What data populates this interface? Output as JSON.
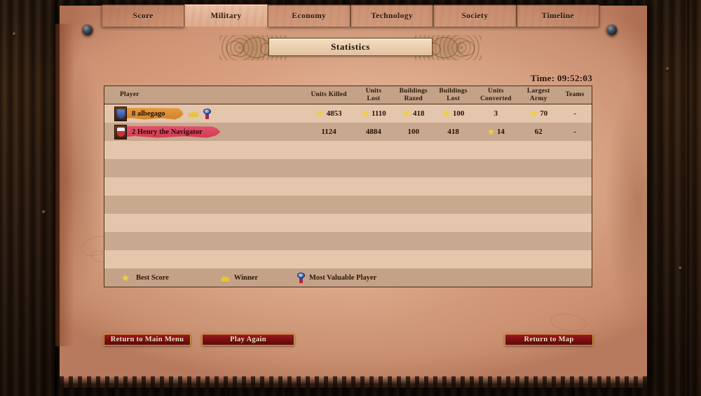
{
  "window": {
    "title": "Statistics"
  },
  "tabs": [
    {
      "id": "score",
      "label": "Score",
      "active": false
    },
    {
      "id": "military",
      "label": "Military",
      "active": true
    },
    {
      "id": "economy",
      "label": "Economy",
      "active": false
    },
    {
      "id": "technology",
      "label": "Technology",
      "active": false
    },
    {
      "id": "society",
      "label": "Society",
      "active": false
    },
    {
      "id": "timeline",
      "label": "Timeline",
      "active": false
    }
  ],
  "time": {
    "label": "Time: 09:52:03"
  },
  "table": {
    "headers": {
      "player": "Player",
      "units_killed": "Units Killed",
      "units_lost_1": "Units",
      "units_lost_2": "Lost",
      "buildings_razed_1": "Buildings",
      "buildings_razed_2": "Razed",
      "buildings_lost_1": "Buildings",
      "buildings_lost_2": "Lost",
      "units_converted_1": "Units",
      "units_converted_2": "Converted",
      "largest_army_1": "Largest",
      "largest_army_2": "Army",
      "teams": "Teams"
    },
    "rows": [
      {
        "rank": "8",
        "name": "albegago",
        "banner_color": "#d9892f",
        "shield_color": "#2f5fae",
        "is_winner": true,
        "is_mvp": true,
        "units_killed": "4853",
        "units_killed_best": true,
        "units_lost": "1110",
        "units_lost_best": true,
        "buildings_razed": "418",
        "buildings_razed_best": true,
        "buildings_lost": "100",
        "buildings_lost_best": true,
        "units_converted": "3",
        "units_converted_best": false,
        "largest_army": "70",
        "largest_army_best": true,
        "teams": "-"
      },
      {
        "rank": "2",
        "name": "Henry the Navigator",
        "banner_color": "#d7445c",
        "shield_color": "#c9333f",
        "is_winner": false,
        "is_mvp": false,
        "units_killed": "1124",
        "units_killed_best": false,
        "units_lost": "4884",
        "units_lost_best": false,
        "buildings_razed": "100",
        "buildings_razed_best": false,
        "buildings_lost": "418",
        "buildings_lost_best": false,
        "units_converted": "14",
        "units_converted_best": true,
        "largest_army": "62",
        "largest_army_best": false,
        "teams": "-"
      }
    ],
    "empty_row_count": 8
  },
  "legend": {
    "best_score": "Best Score",
    "winner": "Winner",
    "mvp": "Most Valuable Player"
  },
  "buttons": {
    "return_main_menu": "Return to Main Menu",
    "play_again": "Play Again",
    "return_to_map": "Return to Map"
  },
  "colors": {
    "parchment": "#ddaa8c",
    "table_header": "#c4a288",
    "row_light": "#e4c6ac",
    "row_dark": "#c8a88e",
    "border": "#4e2c14",
    "button_red": "#7d0f12",
    "button_gold": "#caa53c",
    "star_gold": "#f0d03a"
  }
}
